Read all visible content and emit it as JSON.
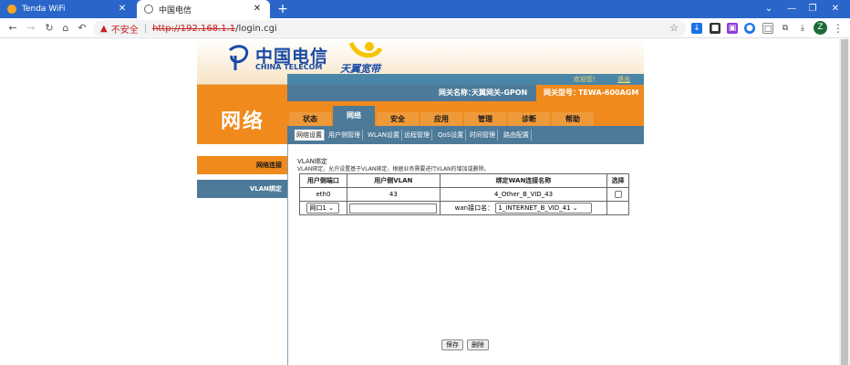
{
  "browser": {
    "tabs": [
      {
        "label": "Tenda WiFi",
        "active": false
      },
      {
        "label": "中国电信",
        "active": true
      }
    ],
    "new_tab": "+",
    "url": {
      "security_label": "不安全",
      "separator": "|",
      "host_part": "http://192.168.1.1",
      "path_part": "/login.cgi"
    },
    "avatar_letter": "Z"
  },
  "header": {
    "brand_cn": "中国电信",
    "brand_en": "CHINA TELECOM",
    "sub_brand": "天翼宽带",
    "welcome": "欢迎您!",
    "logout": "退出",
    "gateway_label": "网关名称：",
    "gateway_value": "天翼网关-GPON",
    "model_label": "网关型号：",
    "model_value": "TEWA-600AGM"
  },
  "section_title": "网络",
  "menu": [
    {
      "label": "状态",
      "active": false
    },
    {
      "label": "网络",
      "active": true
    },
    {
      "label": "安全",
      "active": false
    },
    {
      "label": "应用",
      "active": false
    },
    {
      "label": "管理",
      "active": false
    },
    {
      "label": "诊断",
      "active": false
    },
    {
      "label": "帮助",
      "active": false
    }
  ],
  "submenu": [
    {
      "label": "网络设置",
      "active": true
    },
    {
      "label": "用户侧管理",
      "active": false
    },
    {
      "label": "WLAN设置",
      "active": false
    },
    {
      "label": "远程管理",
      "active": false
    },
    {
      "label": "QoS设置",
      "active": false
    },
    {
      "label": "时间管理",
      "active": false
    },
    {
      "label": "路由配置",
      "active": false
    }
  ],
  "sidebar": [
    {
      "label": "网络连接",
      "active": false
    },
    {
      "label": "VLAN绑定",
      "active": true
    }
  ],
  "content": {
    "title": "VLAN绑定",
    "description": "VLAN绑定，允许设置基于VLAN绑定，根据业务需要进行VLAN的增加或删除。",
    "table": {
      "headers": [
        "用户侧端口",
        "用户侧VLAN",
        "绑定WAN连接名称",
        "选择"
      ],
      "rows": [
        {
          "port": "eth0",
          "vlan": "43",
          "wan": "4_Other_B_VID_43"
        }
      ],
      "new_row": {
        "port_select": "网口1",
        "wan_label": "wan接口名：",
        "wan_select": "1_INTERNET_B_VID_41"
      }
    },
    "save_button": "保存",
    "delete_button": "删除"
  }
}
